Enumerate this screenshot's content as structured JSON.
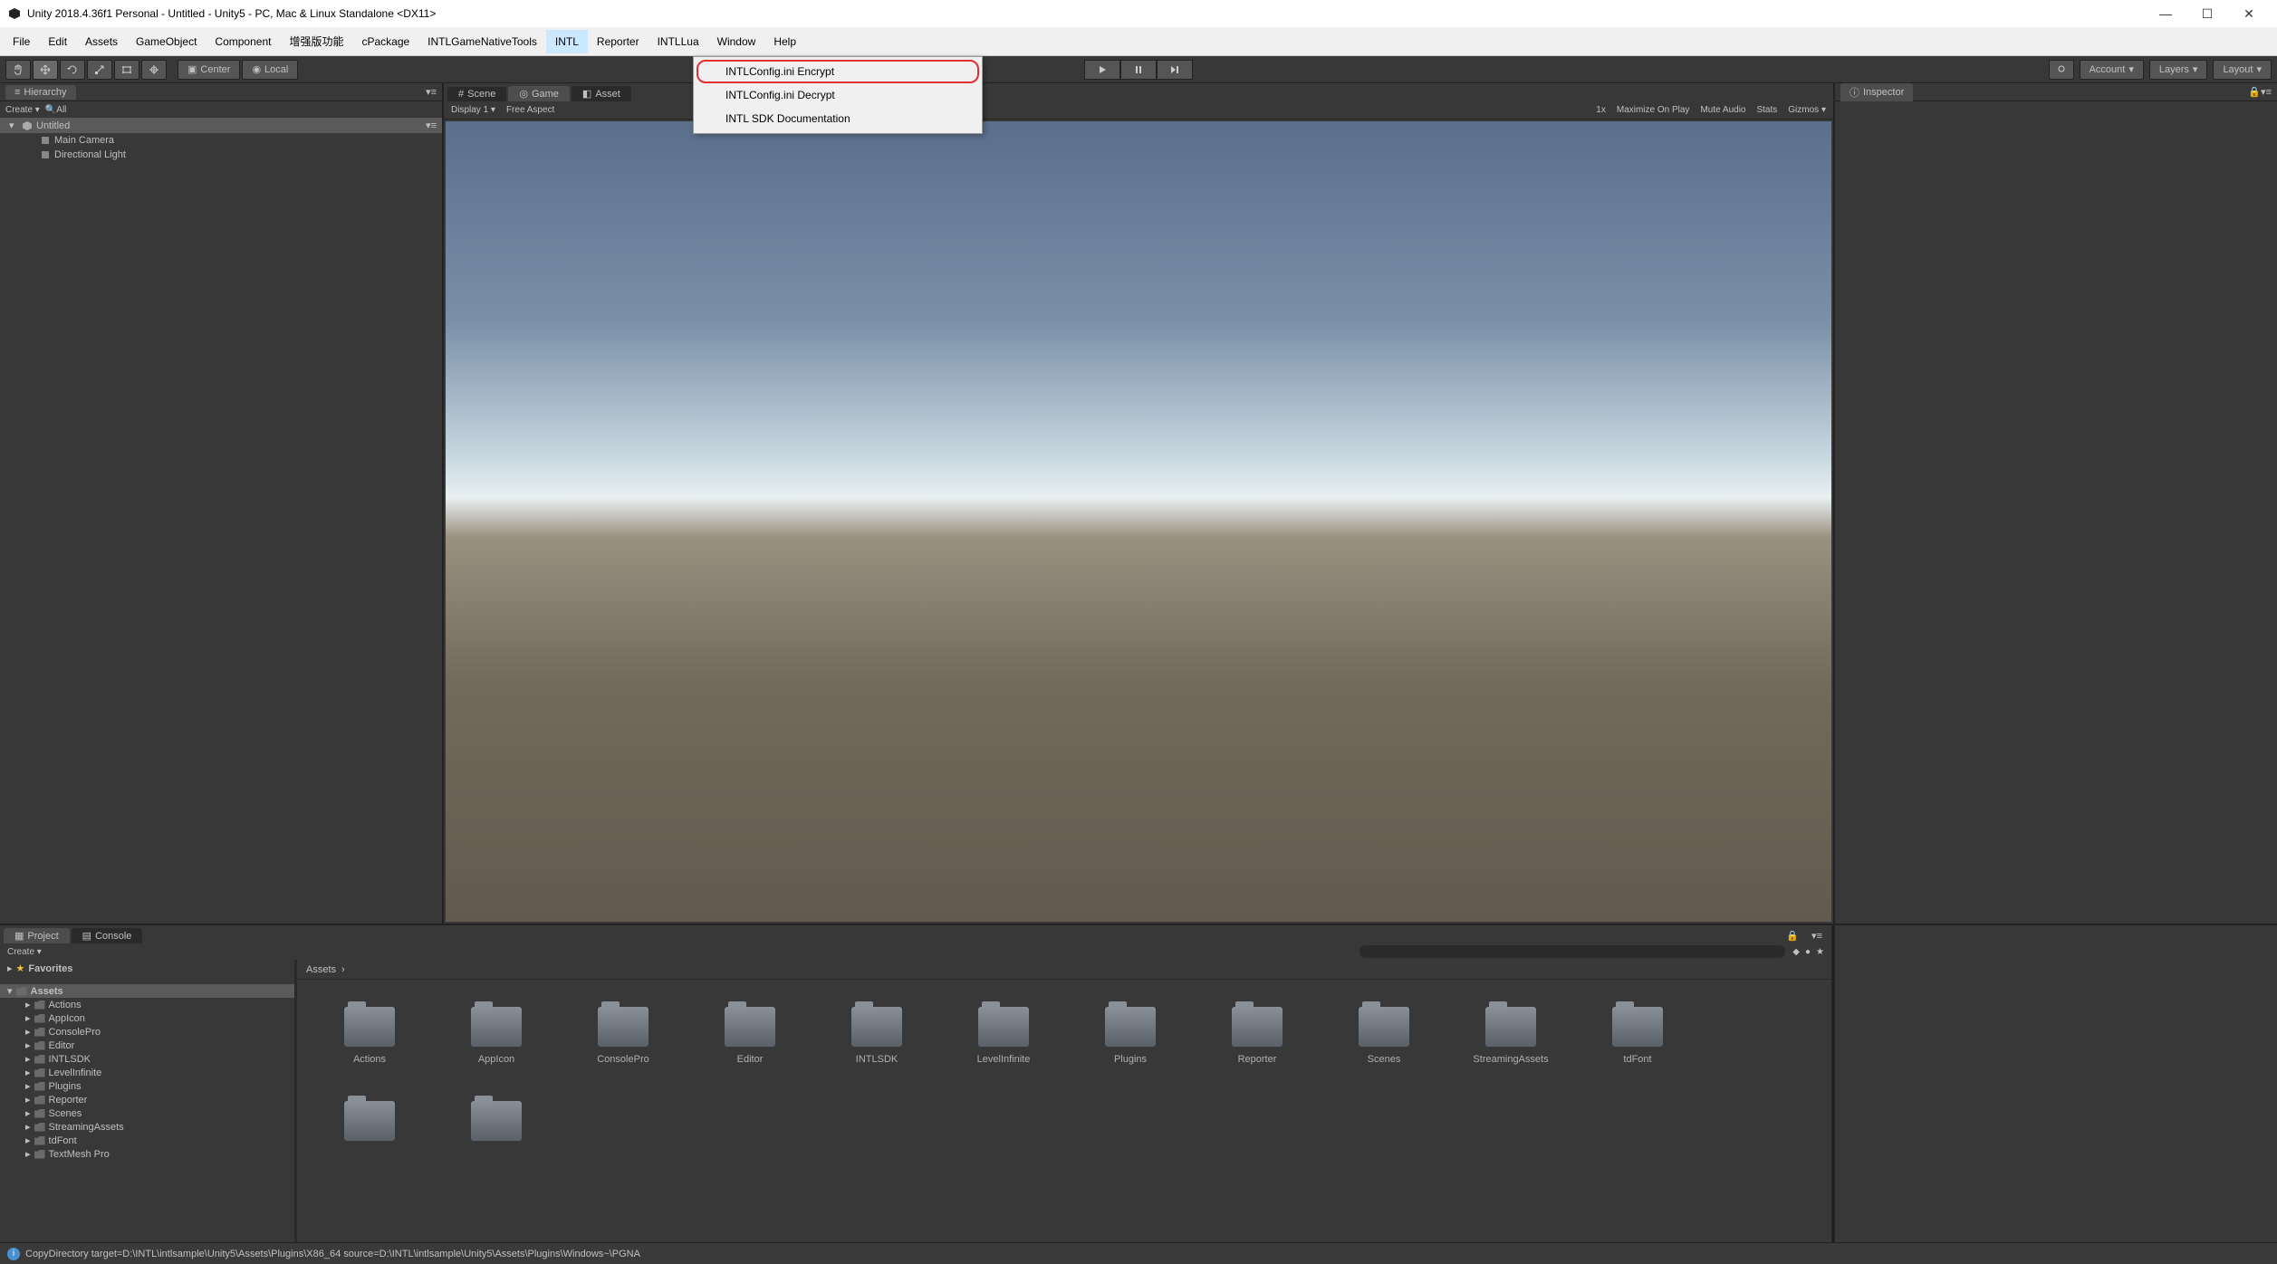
{
  "window": {
    "title": "Unity 2018.4.36f1 Personal - Untitled - Unity5 - PC, Mac & Linux Standalone <DX11>"
  },
  "menubar": {
    "items": [
      "File",
      "Edit",
      "Assets",
      "GameObject",
      "Component",
      "增强版功能",
      "cPackage",
      "INTLGameNativeTools",
      "INTL",
      "Reporter",
      "INTLLua",
      "Window",
      "Help"
    ],
    "active_index": 8
  },
  "dropdown": {
    "items": [
      "INTLConfig.ini Encrypt",
      "INTLConfig.ini Decrypt",
      "INTL SDK Documentation"
    ],
    "highlighted_index": 0
  },
  "toolbar": {
    "pivot": "Center",
    "space": "Local",
    "account": "Account",
    "layers": "Layers",
    "layout": "Layout"
  },
  "hierarchy": {
    "title": "Hierarchy",
    "create": "Create",
    "filter": "All",
    "root": "Untitled",
    "items": [
      "Main Camera",
      "Directional Light"
    ]
  },
  "center": {
    "tabs": [
      "Scene",
      "Game",
      "Asset"
    ],
    "active_tab": 1,
    "display": "Display 1",
    "aspect": "Free Aspect",
    "scale_label": "1x",
    "options": [
      "Maximize On Play",
      "Mute Audio",
      "Stats",
      "Gizmos"
    ]
  },
  "inspector": {
    "title": "Inspector"
  },
  "project": {
    "tabs": [
      "Project",
      "Console"
    ],
    "active_tab": 0,
    "create": "Create",
    "breadcrumb": "Assets",
    "tree": {
      "favorites": "Favorites",
      "assets": "Assets",
      "folders": [
        "Actions",
        "AppIcon",
        "ConsolePro",
        "Editor",
        "INTLSDK",
        "LevelInfinite",
        "Plugins",
        "Reporter",
        "Scenes",
        "StreamingAssets",
        "tdFont",
        "TextMesh Pro"
      ]
    },
    "grid": [
      "Actions",
      "AppIcon",
      "ConsolePro",
      "Editor",
      "INTLSDK",
      "LevelInfinite",
      "Plugins",
      "Reporter",
      "Scenes",
      "StreamingAssets",
      "tdFont"
    ]
  },
  "statusbar": {
    "message": "CopyDirectory target=D:\\INTL\\intlsample\\Unity5\\Assets\\Plugins\\X86_64 source=D:\\INTL\\intlsample\\Unity5\\Assets\\Plugins\\Windows~\\PGNA"
  }
}
